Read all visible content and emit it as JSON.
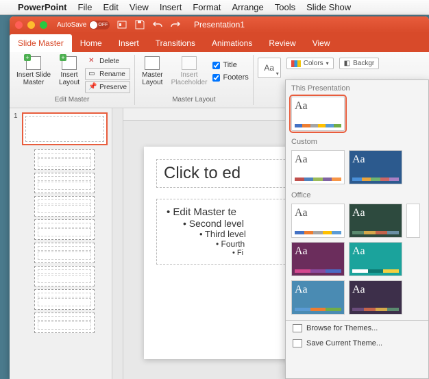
{
  "menubar": {
    "app": "PowerPoint",
    "items": [
      "File",
      "Edit",
      "View",
      "Insert",
      "Format",
      "Arrange",
      "Tools",
      "Slide Show"
    ]
  },
  "window": {
    "title": "Presentation1",
    "autosave_label": "AutoSave",
    "autosave_state": "OFF"
  },
  "tabs": {
    "active": "Slide Master",
    "others": [
      "Home",
      "Insert",
      "Transitions",
      "Animations",
      "Review",
      "View"
    ]
  },
  "ribbon": {
    "insert_slide_master": "Insert Slide\nMaster",
    "insert_layout": "Insert\nLayout",
    "delete": "Delete",
    "rename": "Rename",
    "preserve": "Preserve",
    "group_edit": "Edit Master",
    "master_layout": "Master\nLayout",
    "insert_placeholder": "Insert\nPlaceholder",
    "group_master_layout": "Master Layout",
    "chk_title": "Title",
    "chk_footers": "Footers",
    "themes_label": "Aa",
    "colors": "Colors",
    "background": "Backgr"
  },
  "thumbs": {
    "number": "1"
  },
  "slide": {
    "title": "Click to ed",
    "l1": "• Edit Master te",
    "l2": "• Second level",
    "l3": "• Third level",
    "l4": "• Fourth",
    "l5": "• Fi"
  },
  "dropdown": {
    "section_this": "This Presentation",
    "section_custom": "Custom",
    "section_office": "Office",
    "browse": "Browse for Themes...",
    "save": "Save Current Theme...",
    "tile_aa": "Aa"
  }
}
